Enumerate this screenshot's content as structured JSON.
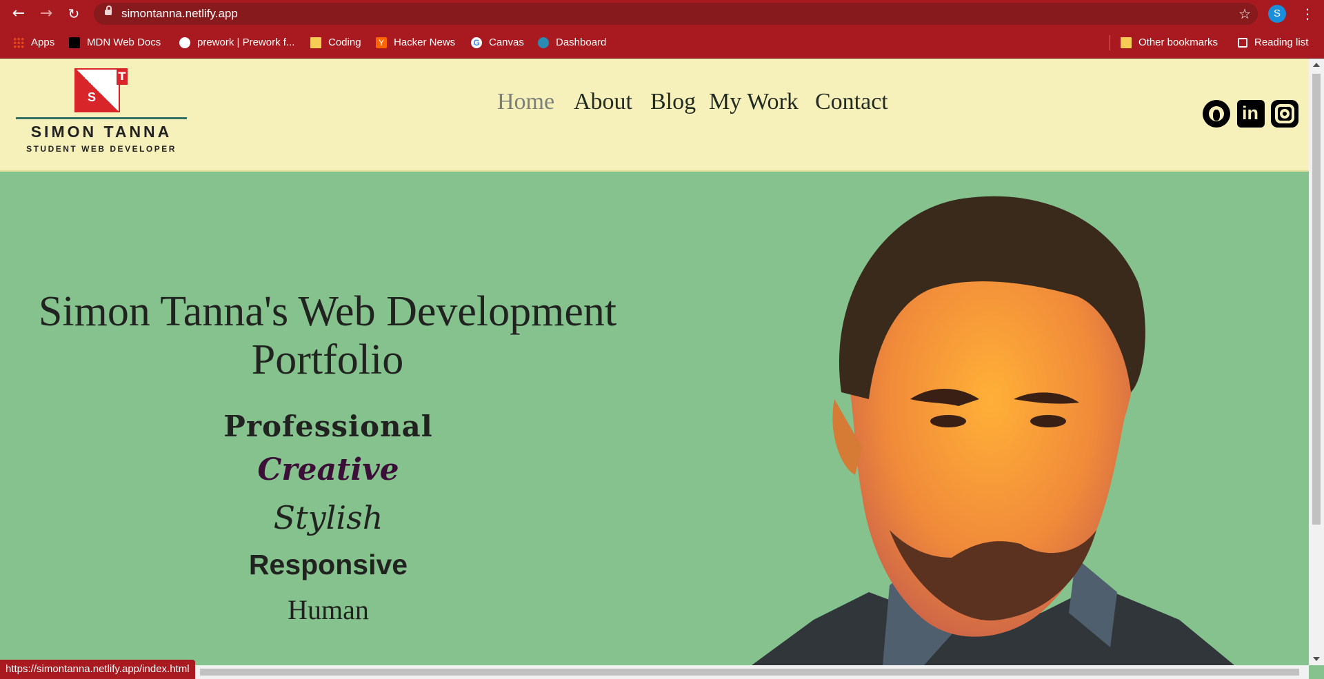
{
  "browser": {
    "url": "simontanna.netlify.app",
    "status_url": "https://simontanna.netlify.app/index.html",
    "profile_initial": "S",
    "bookmarks": [
      {
        "label": "Apps",
        "icon": "apps-grid-icon"
      },
      {
        "label": "MDN Web Docs",
        "icon": "mdn-icon"
      },
      {
        "label": "prework | Prework f...",
        "icon": "globe-icon"
      },
      {
        "label": "Coding",
        "icon": "folder-icon"
      },
      {
        "label": "Hacker News",
        "icon": "hacker-news-icon"
      },
      {
        "label": "Canvas",
        "icon": "google-icon"
      },
      {
        "label": "Dashboard",
        "icon": "dashboard-icon"
      }
    ],
    "other_bookmarks": "Other bookmarks",
    "reading_list": "Reading list"
  },
  "site": {
    "logo": {
      "letter_t": "T",
      "letter_s": "S",
      "name": "SIMON TANNA",
      "tagline": "STUDENT WEB DEVELOPER"
    },
    "nav": [
      "Home",
      "About",
      "Blog",
      "My Work",
      "Contact"
    ],
    "active_nav": "Home",
    "social": [
      "github-icon",
      "linkedin-icon",
      "instagram-icon"
    ]
  },
  "hero": {
    "title": "Simon Tanna's Web Development Portfolio",
    "traits": [
      "Professional",
      "Creative",
      "Stylish",
      "Responsive",
      "Human"
    ]
  },
  "colors": {
    "chrome": "#a81a1f",
    "header_bg": "#f6f1bb",
    "hero_bg": "#86c28e",
    "logo_red": "#d8252a",
    "logo_rule": "#306f62"
  }
}
